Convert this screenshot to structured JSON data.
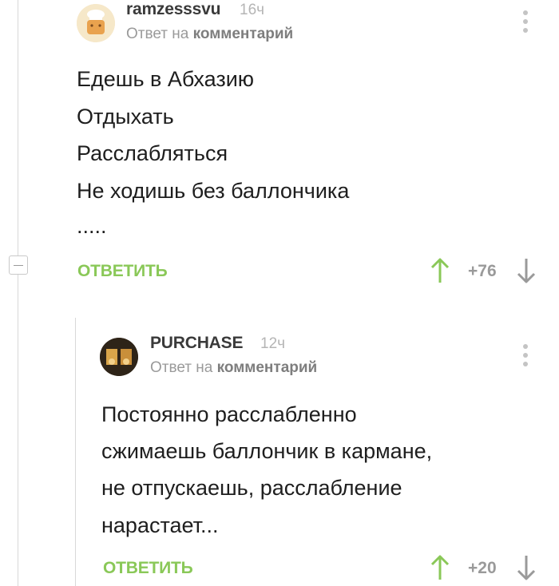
{
  "comment1": {
    "username": "ramzesssvu",
    "time": "16ч",
    "reply_prefix": "Ответ на",
    "reply_target": "комментарий",
    "lines": [
      "Едешь в Абхазию",
      "Отдыхать",
      "Расслабляться",
      "Не ходишь без баллончика",
      "....."
    ],
    "reply_label": "ОТВЕТИТЬ",
    "rating": "+76"
  },
  "comment2": {
    "username": "PURCHASE",
    "time": "12ч",
    "reply_prefix": "Ответ на",
    "reply_target": "комментарий",
    "lines": [
      "Постоянно расслабленно",
      "сжимаешь баллончик в кармане,",
      "не отпускаешь, расслабление",
      "нарастает..."
    ],
    "reply_label": "ОТВЕТИТЬ",
    "rating": "+20"
  },
  "colors": {
    "accent_green": "#8ac858",
    "muted_gray": "#9a9a9a",
    "thread_line": "#d8d8d8"
  }
}
